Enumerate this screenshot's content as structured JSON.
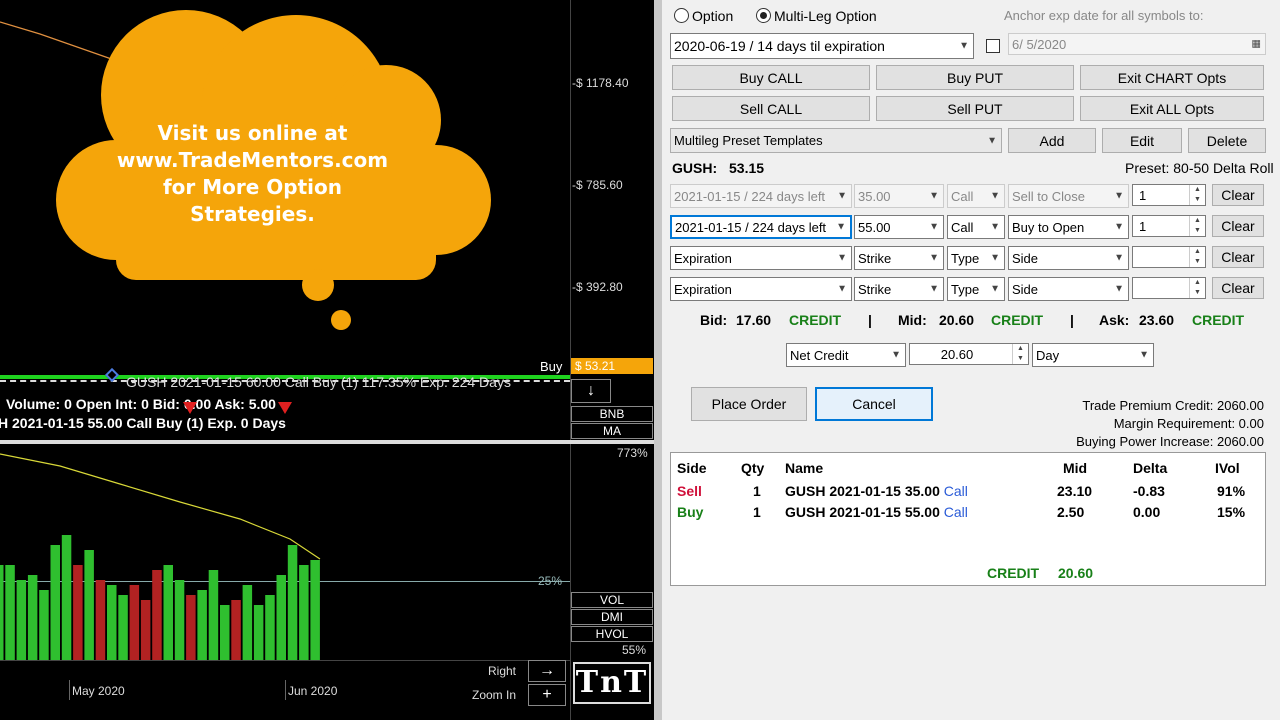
{
  "chart": {
    "price_labels": [
      "-$ 1178.40",
      "-$ 785.60",
      "-$ 392.80"
    ],
    "buy_marker": "Buy",
    "last_price": "$ 53.21",
    "order_line_text": "GUSH 2021-01-15 60.00 Call Buy (1)  117.35% Exp. 224 Days",
    "quote_line": "Volume: 0 Open Int: 0 Bid: 0.00 Ask: 5.00",
    "leg_line": "H 2021-01-15 55.00 Call Buy (1) Exp. 0 Days",
    "overlay_buttons": [
      "BNB",
      "MA"
    ],
    "down_button": "↓",
    "lower_pct_top": "773%",
    "lower_pct_mid": "25%",
    "lower_pct_bottom": "55%",
    "indicator_buttons": [
      "VOL",
      "DMI",
      "HVOL"
    ],
    "right_label": "Right",
    "right_button": "→",
    "zoom_label": "Zoom In",
    "zoom_button": "+",
    "x_labels": [
      "May 2020",
      "Jun 2020"
    ],
    "logo": "TnT",
    "cloud_text": "Visit us online at www.TradeMentors.com for More Option Strategies."
  },
  "form": {
    "radio_option": "Option",
    "radio_multileg": "Multi-Leg Option",
    "anchor_label": "Anchor exp date for all symbols to:",
    "expiration_select": "2020-06-19 / 14 days til expiration",
    "anchor_date": "6/  5/2020",
    "buttons_row1": [
      "Buy CALL",
      "Buy PUT",
      "Exit CHART Opts"
    ],
    "buttons_row2": [
      "Sell CALL",
      "Sell PUT",
      "Exit ALL Opts"
    ],
    "preset_select": "Multileg Preset Templates",
    "add": "Add",
    "edit": "Edit",
    "delete": "Delete",
    "symbol_label": "GUSH:",
    "symbol_price": "53.15",
    "preset_label": "Preset: 80-50 Delta Roll",
    "legs": [
      {
        "exp": "2021-01-15 / 224 days left",
        "strike": "35.00",
        "type": "Call",
        "side": "Sell to Close",
        "qty": "1",
        "clear": "Clear",
        "disabled": true
      },
      {
        "exp": "2021-01-15 / 224 days left",
        "strike": "55.00",
        "type": "Call",
        "side": "Buy to Open",
        "qty": "1",
        "clear": "Clear",
        "disabled": false
      },
      {
        "exp": "Expiration",
        "strike": "Strike",
        "type": "Type",
        "side": "Side",
        "qty": "",
        "clear": "Clear",
        "disabled": false
      },
      {
        "exp": "Expiration",
        "strike": "Strike",
        "type": "Type",
        "side": "Side",
        "qty": "",
        "clear": "Clear",
        "disabled": false
      }
    ],
    "bid_label": "Bid:",
    "bid_value": "17.60",
    "mid_label": "Mid:",
    "mid_value": "20.60",
    "ask_label": "Ask:",
    "ask_value": "23.60",
    "credit_word": "CREDIT",
    "sep": "|",
    "order_type": "Net Credit",
    "limit_price": "20.60",
    "tif": "Day",
    "place_order": "Place Order",
    "cancel": "Cancel",
    "trade_premium": "Trade Premium Credit: 2060.00",
    "margin_req": "Margin Requirement: 0.00",
    "buying_power": "Buying Power Increase: 2060.00"
  },
  "table": {
    "headers": [
      "Side",
      "Qty",
      "Name",
      "Mid",
      "Delta",
      "IVol"
    ],
    "rows": [
      {
        "side": "Sell",
        "qty": "1",
        "name": "GUSH 2021-01-15 35.00",
        "type": "Call",
        "mid": "23.10",
        "delta": "-0.83",
        "ivol": "91%"
      },
      {
        "side": "Buy",
        "qty": "1",
        "name": "GUSH 2021-01-15 55.00",
        "type": "Call",
        "mid": "2.50",
        "delta": "0.00",
        "ivol": "15%"
      }
    ],
    "total_label": "CREDIT",
    "total_value": "20.60"
  },
  "colors": {
    "cloud": "#f5a50a",
    "sell": "#d0103a",
    "buy": "#188018",
    "call": "#2a5bd7",
    "bar_green": "#2fbf2f",
    "bar_red": "#b22222"
  }
}
